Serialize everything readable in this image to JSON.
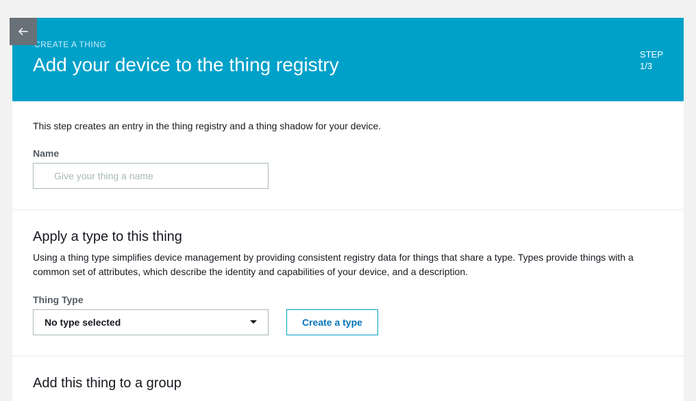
{
  "banner": {
    "crumb": "CREATE A THING",
    "title": "Add your device to the thing registry",
    "step_label": "STEP",
    "step_value": "1/3"
  },
  "intro": "This step creates an entry in the thing registry and a thing shadow for your device.",
  "name_field": {
    "label": "Name",
    "placeholder": "Give your thing a name",
    "value": ""
  },
  "type_section": {
    "title": "Apply a type to this thing",
    "desc": "Using a thing type simplifies device management by providing consistent registry data for things that share a type. Types provide things with a common set of attributes, which describe the identity and capabilities of your device, and a description.",
    "field_label": "Thing Type",
    "selected": "No type selected",
    "create_label": "Create a type"
  },
  "group_section": {
    "title": "Add this thing to a group"
  }
}
